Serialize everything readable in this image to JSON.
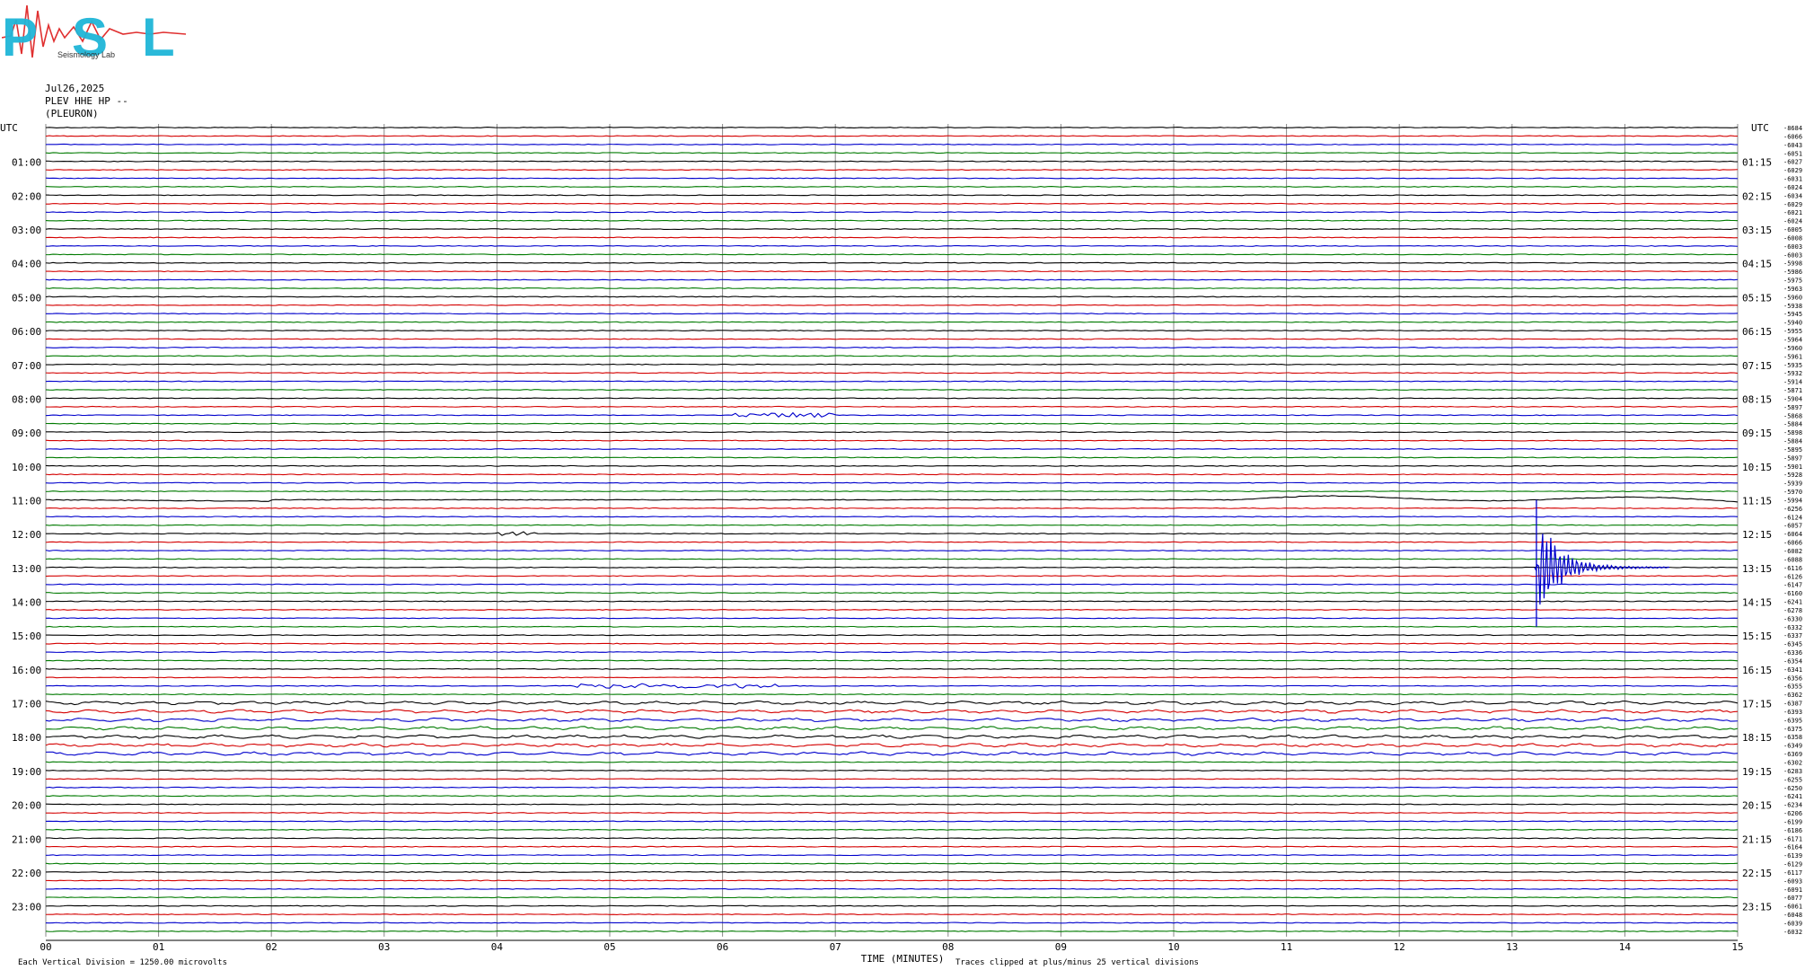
{
  "header": {
    "logo_text": "PSL",
    "logo_subtitle": "Seismology Lab",
    "date": "Jul26,2025",
    "station": "PLEV HHE HP --",
    "location": "(PLEURON)"
  },
  "colors": {
    "trace_cycle": [
      "#000000",
      "#d40000",
      "#0000cc",
      "#007a00"
    ],
    "grid": "#888888",
    "logo_blue": "#1fb6d8",
    "logo_red": "#e03030"
  },
  "chart_data": {
    "type": "line",
    "title": "",
    "left_axis_label": "UTC",
    "right_axis_label": "UTC",
    "xlabel": "TIME (MINUTES)",
    "x_ticks": [
      "00",
      "01",
      "02",
      "03",
      "04",
      "05",
      "06",
      "07",
      "08",
      "09",
      "10",
      "11",
      "12",
      "13",
      "14",
      "15"
    ],
    "xlim": [
      0,
      15
    ],
    "rows_per_hour": 4,
    "row_count": 96,
    "left_hour_labels": [
      "UTC",
      "01:00",
      "02:00",
      "03:00",
      "04:00",
      "05:00",
      "06:00",
      "07:00",
      "08:00",
      "09:00",
      "10:00",
      "11:00",
      "12:00",
      "13:00",
      "14:00",
      "15:00",
      "16:00",
      "17:00",
      "18:00",
      "19:00",
      "20:00",
      "21:00",
      "22:00",
      "23:00"
    ],
    "right_hour_labels": [
      "UTC",
      "01:15",
      "02:15",
      "03:15",
      "04:15",
      "05:15",
      "06:15",
      "07:15",
      "08:15",
      "09:15",
      "10:15",
      "11:15",
      "12:15",
      "13:15",
      "14:15",
      "15:15",
      "16:15",
      "17:15",
      "18:15",
      "19:15",
      "20:15",
      "21:15",
      "22:15",
      "23:15"
    ],
    "right_offsets": [
      "-8684",
      "-6066",
      "-6043",
      "-6051",
      "-6027",
      "-6029",
      "-6031",
      "-6024",
      "-6034",
      "-6029",
      "-6021",
      "-6024",
      "-6005",
      "-6008",
      "-6003",
      "-6003",
      "-5998",
      "-5986",
      "-5975",
      "-5963",
      "-5960",
      "-5938",
      "-5945",
      "-5940",
      "-5955",
      "-5964",
      "-5960",
      "-5961",
      "-5935",
      "-5932",
      "-5914",
      "-5871",
      "-5904",
      "-5897",
      "-5868",
      "-5884",
      "-5898",
      "-5884",
      "-5895",
      "-5897",
      "-5901",
      "-5928",
      "-5939",
      "-5970",
      "-5994",
      "-6256",
      "-6124",
      "-6057",
      "-6064",
      "-6066",
      "-6082",
      "-6088",
      "-6116",
      "-6126",
      "-6147",
      "-6160",
      "-6241",
      "-6278",
      "-6330",
      "-6332",
      "-6337",
      "-6345",
      "-6336",
      "-6354",
      "-6341",
      "-6356",
      "-6355",
      "-6362",
      "-6387",
      "-6393",
      "-6395",
      "-6375",
      "-6358",
      "-6349",
      "-6369",
      "-6302",
      "-6283",
      "-6255",
      "-6250",
      "-6241",
      "-6234",
      "-6206",
      "-6199",
      "-6186",
      "-6171",
      "-6164",
      "-6139",
      "-6129",
      "-6117",
      "-6093",
      "-6091",
      "-6077",
      "-6061",
      "-6048",
      "-6039",
      "-6032"
    ],
    "events": [
      {
        "row": 44,
        "type": "long-period swell",
        "x_start": 10.6,
        "x_end": 15.0
      },
      {
        "row": 52,
        "type": "earthquake",
        "x_start": 13.2,
        "x_end": 14.4,
        "rows_spanned": 15
      },
      {
        "row": 66,
        "type": "burst",
        "x_start": 4.7,
        "x_end": 6.5
      },
      {
        "row": 34,
        "type": "burst",
        "x_start": 6.1,
        "x_end": 7.0
      },
      {
        "row": 48,
        "type": "burst",
        "x_start": 4.0,
        "x_end": 4.35
      }
    ],
    "grid": true
  },
  "footer": {
    "scale_note": "Each Vertical Division = 1250.00 microvolts",
    "clip_note": "Traces clipped at plus/minus 25 vertical divisions"
  }
}
